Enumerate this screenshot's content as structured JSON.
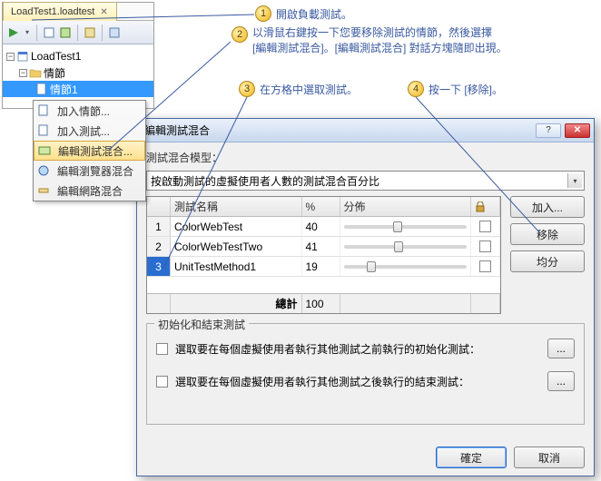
{
  "panel": {
    "tab": "LoadTest1.loadtest",
    "tree": {
      "root": "LoadTest1",
      "node_situation": "情節",
      "node_situation1": "情節1"
    }
  },
  "contextMenu": {
    "addSituation": "加入情節...",
    "addTest": "加入測試...",
    "editTestMix": "編輯測試混合...",
    "editBrowserMix": "編輯瀏覽器混合",
    "editNetworkMix": "編輯網路混合"
  },
  "dialog": {
    "title": "編輯測試混合",
    "modelLabel": "測試混合模型：",
    "modelValue": "按啟動測試的虛擬使用者人數的測試混合百分比",
    "grid": {
      "colBlank": "",
      "colName": "測試名稱",
      "colPct": "%",
      "colDist": "分佈",
      "colLock": "",
      "rows": [
        {
          "num": "1",
          "name": "ColorWebTest",
          "pct": "40",
          "slider": 40
        },
        {
          "num": "2",
          "name": "ColorWebTestTwo",
          "pct": "41",
          "slider": 41
        },
        {
          "num": "3",
          "name": "UnitTestMethod1",
          "pct": "19",
          "slider": 19
        }
      ],
      "totalLabel": "總計",
      "totalPct": "100"
    },
    "buttons": {
      "add": "加入...",
      "remove": "移除",
      "distribute": "均分"
    },
    "group": {
      "title": "初始化和結束測試",
      "initLabel": "選取要在每個虛擬使用者執行其他測試之前執行的初始化測試：",
      "endLabel": "選取要在每個虛擬使用者執行其他測試之後執行的結束測試：",
      "browse": "..."
    },
    "ok": "確定",
    "cancel": "取消"
  },
  "callouts": {
    "c1": "開啟負載測試。",
    "c2a": "以滑鼠右鍵按一下您要移除測試的情節，然後選擇",
    "c2b": "[編輯測試混合]。[編輯測試混合] 對話方塊隨即出現。",
    "c3": "在方格中選取測試。",
    "c4": "按一下 [移除]。"
  }
}
